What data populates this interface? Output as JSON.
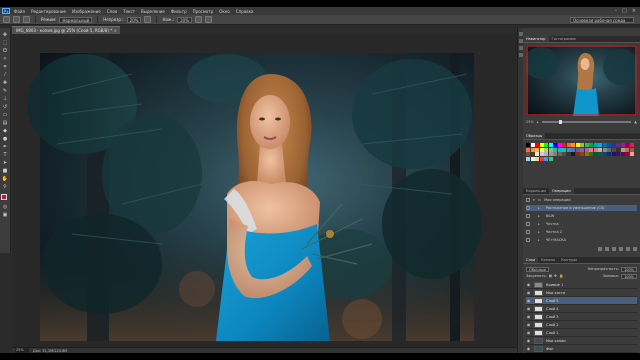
{
  "menu": {
    "logo": "Ps",
    "items": [
      "Файл",
      "Редактирование",
      "Изображение",
      "Слои",
      "Текст",
      "Выделение",
      "Фильтр",
      "Просмотр",
      "Окно",
      "Справка"
    ],
    "window_buttons": [
      "–",
      "□",
      "×"
    ]
  },
  "options": {
    "mode_label": "Режим:",
    "mode_value": "Нормальный",
    "opacity_label": "Непрозр.:",
    "opacity_value": "20%",
    "flow_label": "Наж.:",
    "flow_value": "20%",
    "workspace": "Основная рабочая среда"
  },
  "document": {
    "tab_title": "IMG_6803 - копия.jpg @ 25% (Слой 5, RGB/8) *",
    "close": "×",
    "zoom": "25%",
    "doc_size": "Док: 31,3M/220,8M"
  },
  "panels": {
    "navigator_tabs": [
      "Навигатор",
      "Гистограмма"
    ],
    "swatch_tabs": [
      "Образцы"
    ],
    "operations_tabs": [
      "Коррекция",
      "Операции"
    ],
    "layers_tabs": [
      "Слои",
      "Каналы",
      "Контуры"
    ]
  },
  "navigator": {
    "zoom": "25%"
  },
  "swatch_colors": [
    "#000000",
    "#ffffff",
    "#ff0000",
    "#ffff00",
    "#00ff00",
    "#00ffff",
    "#0000ff",
    "#ff00ff",
    "#ed1c24",
    "#f26522",
    "#f7941d",
    "#fff200",
    "#8dc63f",
    "#39b54a",
    "#00a651",
    "#00a99d",
    "#00aeef",
    "#0072bc",
    "#0054a6",
    "#2e3192",
    "#662d91",
    "#92278f",
    "#9e005d",
    "#ed145b",
    "#f26c4f",
    "#f68e56",
    "#fbaf5d",
    "#fff568",
    "#acd373",
    "#7cc576",
    "#3cb878",
    "#1cbbb4",
    "#00bff3",
    "#448ccb",
    "#5674b9",
    "#605ca8",
    "#8560a8",
    "#a864a8",
    "#f06eaa",
    "#f26d7d",
    "#c7b299",
    "#998675",
    "#736357",
    "#534741",
    "#37302d",
    "#c69c6d",
    "#a67c52",
    "#8c6239",
    "#754c24",
    "#603913",
    "#e6e6e6",
    "#cccccc",
    "#b3b3b3",
    "#999999",
    "#808080",
    "#666666",
    "#4d4d4d",
    "#333333",
    "#1a1a1a",
    "#7d2c2c",
    "#a0410d",
    "#827b00",
    "#406618",
    "#005e20",
    "#005952",
    "#004a80",
    "#003471",
    "#1b1464",
    "#440e62",
    "#630460",
    "#9e0039",
    "#ff9999",
    "#99ccff",
    "#ccffcc",
    "#ffcc99",
    "#ff3333",
    "#3399ff",
    "#33cc66"
  ],
  "operations": {
    "items": [
      {
        "label": "Мои операции",
        "indent": 0,
        "highlight": false
      },
      {
        "label": "Растяжение и уменьшение (CS)",
        "indent": 1,
        "highlight": true
      },
      {
        "label": "B&W",
        "indent": 1,
        "highlight": false
      },
      {
        "label": "Чистка",
        "indent": 1,
        "highlight": false
      },
      {
        "label": "Чистка 2",
        "indent": 1,
        "highlight": false
      },
      {
        "label": "ЧЕ+МАСКА",
        "indent": 1,
        "highlight": false
      }
    ]
  },
  "layers": {
    "blend_mode": "Обычные",
    "opacity_label": "Непрозрачность:",
    "opacity_value": "100%",
    "lock_label": "Закрепить:",
    "fill_label": "Заливка:",
    "fill_value": "100%",
    "items": [
      {
        "name": "Кривые 1",
        "active": false
      },
      {
        "name": "Мои кисти",
        "active": false
      },
      {
        "name": "Слой 5",
        "active": true
      },
      {
        "name": "Слой 4",
        "active": false
      },
      {
        "name": "Слой 3",
        "active": false
      },
      {
        "name": "Слой 2",
        "active": false
      },
      {
        "name": "Слой 1",
        "active": false
      },
      {
        "name": "Мои копии",
        "active": false
      },
      {
        "name": "Фон",
        "active": false
      }
    ]
  }
}
